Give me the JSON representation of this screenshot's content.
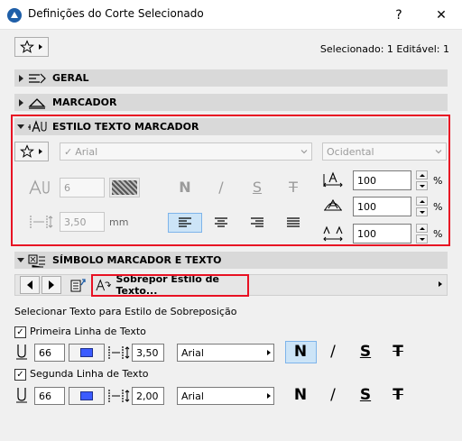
{
  "window": {
    "title": "Definições do Corte Selecionado",
    "help": "?",
    "close": "✕"
  },
  "selection_info": "Selecionado: 1 Editável: 1",
  "sections": {
    "geral": "GERAL",
    "marcador": "MARCADOR",
    "estilo": "ESTILO TEXTO MARCADOR",
    "simbolo": "SÍMBOLO MARCADOR E TEXTO"
  },
  "estilo": {
    "font": "Arial",
    "script": "Ocidental",
    "size": "6",
    "spacing": "3,50",
    "unit": "mm",
    "styles": {
      "bold": "N",
      "italic": "/",
      "underline": "S",
      "strike": "T"
    },
    "width_factor": "100",
    "slant": "100",
    "char_spacing": "100",
    "percent": "%"
  },
  "override_button": "Sobrepor Estilo de Texto...",
  "select_label": "Selecionar Texto para Estilo de Sobreposição",
  "line1": {
    "label": "Primeira Linha de Texto",
    "pen": "66",
    "spacing": "3,50",
    "font": "Arial"
  },
  "line2": {
    "label": "Segunda Linha de Texto",
    "pen": "66",
    "spacing": "2,00",
    "font": "Arial"
  },
  "style_glyphs": {
    "bold": "N",
    "italic": "/",
    "underline": "S",
    "strike": "T"
  },
  "colors": {
    "accent_red": "#e81123",
    "swatch_blue": "#3b5bff",
    "section_bg": "#d9d9d9"
  }
}
